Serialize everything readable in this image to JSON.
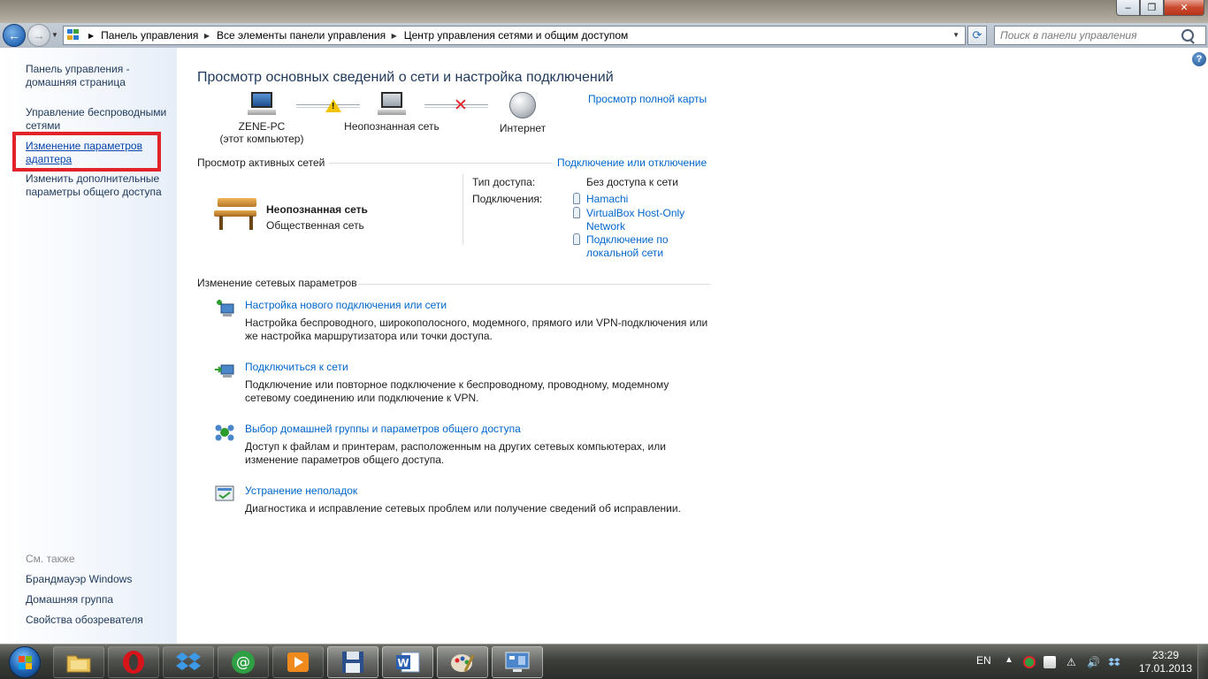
{
  "window": {
    "minimize_glyph": "‒",
    "maximize_glyph": "❐",
    "close_glyph": "✕"
  },
  "nav": {
    "back_glyph": "←",
    "forward_glyph": "→",
    "breadcrumbs": [
      "Панель управления",
      "Все элементы панели управления",
      "Центр управления сетями и общим доступом"
    ],
    "search_placeholder": "Поиск в панели управления"
  },
  "sidebar": {
    "items": [
      {
        "label": "Панель управления - домашняя страница"
      },
      {
        "label": "Управление беспроводными сетями"
      },
      {
        "label": "Изменение параметров адаптера"
      },
      {
        "label": "Изменить дополнительные параметры общего доступа"
      }
    ],
    "see_also_heading": "См. также",
    "see_also": [
      {
        "label": "Брандмауэр Windows"
      },
      {
        "label": "Домашняя группа"
      },
      {
        "label": "Свойства обозревателя"
      }
    ]
  },
  "main": {
    "title": "Просмотр основных сведений о сети и настройка подключений",
    "full_map_link": "Просмотр полной карты",
    "map": {
      "computer_name": "ZENE-PC",
      "computer_sub": "(этот компьютер)",
      "network_label": "Неопознанная сеть",
      "internet_label": "Интернет"
    },
    "active_networks": {
      "heading": "Просмотр активных сетей",
      "connect_link": "Подключение или отключение",
      "network_name": "Неопознанная сеть",
      "network_type": "Общественная сеть",
      "access_type_label": "Тип доступа:",
      "access_type_value": "Без доступа к сети",
      "connections_label": "Подключения:",
      "connections": [
        "Hamachi",
        "VirtualBox Host-Only Network",
        "Подключение по локальной сети"
      ]
    },
    "change_settings": {
      "heading": "Изменение сетевых параметров",
      "tasks": [
        {
          "title": "Настройка нового подключения или сети",
          "desc": "Настройка беспроводного, широкополосного, модемного, прямого или VPN-подключения или же настройка маршрутизатора или точки доступа.",
          "icon": "new-connection-icon"
        },
        {
          "title": "Подключиться к сети",
          "desc": "Подключение или повторное подключение к беспроводному, проводному, модемному сетевому соединению или подключение к VPN.",
          "icon": "connect-network-icon"
        },
        {
          "title": "Выбор домашней группы и параметров общего доступа",
          "desc": "Доступ к файлам и принтерам, расположенным на других сетевых компьютерах, или изменение параметров общего доступа.",
          "icon": "homegroup-icon"
        },
        {
          "title": "Устранение неполадок",
          "desc": "Диагностика и исправление сетевых проблем или получение сведений об исправлении.",
          "icon": "troubleshoot-icon"
        }
      ]
    }
  },
  "taskbar": {
    "apps": [
      "explorer",
      "opera",
      "dropbox",
      "mail-agent",
      "media-player",
      "save",
      "word",
      "paint",
      "control-panel"
    ],
    "language": "EN",
    "time": "23:29",
    "date": "17.01.2013"
  },
  "colors": {
    "link": "#0066cc",
    "highlight": "#e2232a",
    "heading": "#1e395b"
  }
}
